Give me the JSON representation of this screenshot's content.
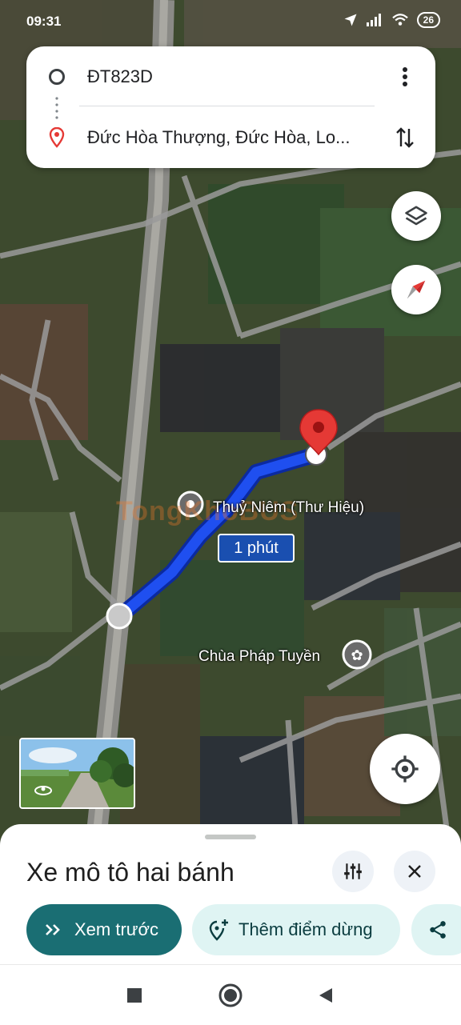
{
  "status": {
    "time": "09:31",
    "battery": "26"
  },
  "route": {
    "origin": "ĐT823D",
    "destination": "Đức Hòa Thượng, Đức Hòa, Lo..."
  },
  "map": {
    "place_label": "Thuỷ Niêm (Thư Hiệu)",
    "temple_label": "Chùa Pháp Tuyền",
    "duration": "1 phút",
    "watermark": "TongKhoBUS"
  },
  "sheet": {
    "mode_title": "Xe mô tô hai bánh",
    "preview_label": "Xem trước",
    "add_stop_label": "Thêm điểm dừng"
  },
  "colors": {
    "route": "#1a3ee0",
    "pin": "#e53935",
    "primary_chip": "#1a6e73",
    "secondary_chip": "#dff4f3"
  },
  "icons": [
    "location-arrow-icon",
    "signal-icon",
    "wifi-icon",
    "more-vert-icon",
    "swap-icon",
    "layers-icon",
    "compass-icon",
    "my-location-icon",
    "sliders-icon",
    "close-icon",
    "chevrons-right-icon",
    "add-stop-icon",
    "share-icon"
  ]
}
